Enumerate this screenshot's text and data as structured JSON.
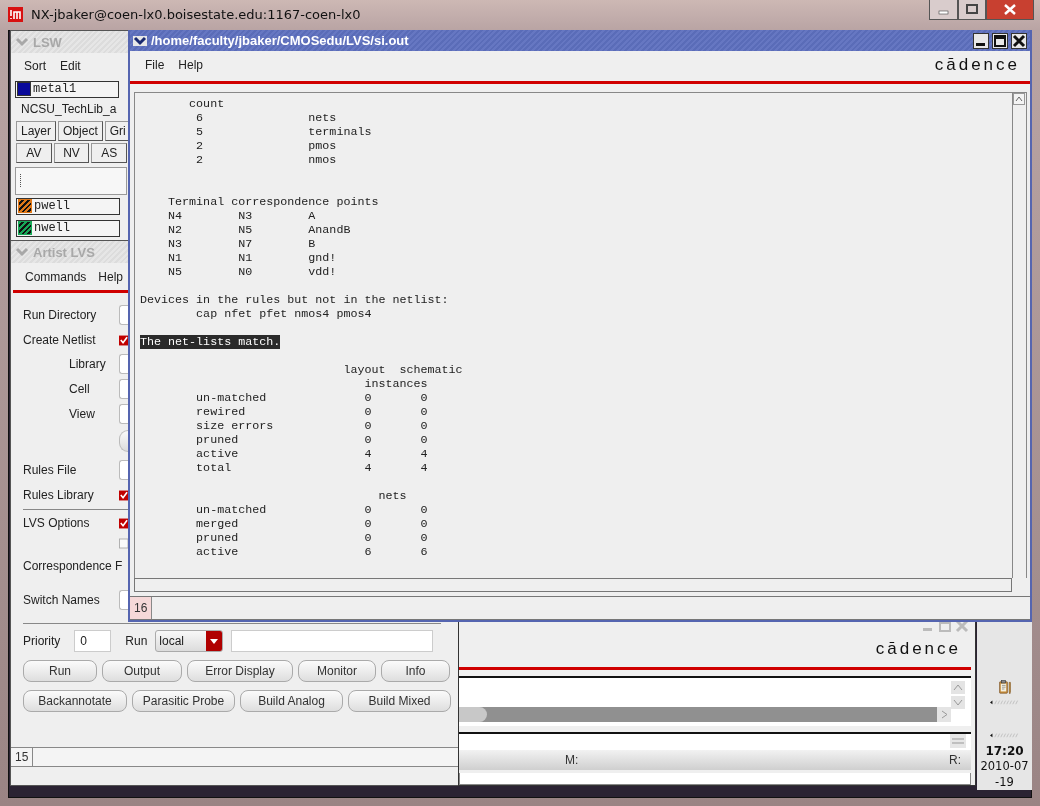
{
  "host_window": {
    "title": "NX-jbaker@coen-lx0.boisestate.edu:1167-coen-lx0"
  },
  "lsw": {
    "title": "LSW",
    "menu": [
      "Sort",
      "Edit"
    ],
    "current_layer": {
      "name": "metal1",
      "color": "#0a0a9a"
    },
    "technology": "NCSU_TechLib_a",
    "tabs": [
      "Layer",
      "Object",
      "Gri"
    ],
    "buttons": [
      "AV",
      "NV",
      "AS"
    ],
    "layers": [
      {
        "name": "pwell",
        "color": "#e07818"
      },
      {
        "name": "nwell",
        "color": "#18a858"
      }
    ]
  },
  "artist_lvs": {
    "title": "Artist LVS",
    "menu": [
      "Commands",
      "Help"
    ],
    "sections": [
      [
        {
          "kind": "field",
          "label": "Run Directory"
        },
        {
          "kind": "checkbox",
          "label": "Create Netlist",
          "checked": true
        },
        {
          "kind": "subfield",
          "label": "Library"
        },
        {
          "kind": "subfield",
          "label": "Cell"
        },
        {
          "kind": "subfield",
          "label": "View"
        },
        {
          "kind": "button"
        },
        {
          "kind": "field",
          "label": "Rules File"
        },
        {
          "kind": "checkbox",
          "label": "Rules Library",
          "checked": true
        }
      ],
      [
        {
          "kind": "checkbox",
          "label": "LVS Options",
          "checked": true
        },
        {
          "kind": "checkbox",
          "checked": false
        },
        {
          "kind": "field",
          "label": "Correspondence F"
        },
        {
          "kind": "field",
          "label": "Switch Names"
        }
      ]
    ],
    "priority": {
      "label": "Priority",
      "value": "0"
    },
    "run": {
      "label": "Run",
      "value": "local"
    },
    "button_rows": [
      [
        "Run",
        "Output",
        "Error Display",
        "Monitor",
        "Info"
      ],
      [
        "Backannotate",
        "Parasitic Probe",
        "Build Analog",
        "Build Mixed"
      ]
    ],
    "status": "15"
  },
  "output_window": {
    "title": "/home/faculty/jbaker/CMOSedu/LVS/si.out",
    "menu": [
      "File",
      "Help"
    ],
    "logo": "cādence",
    "blocks": [
      {
        "highlighted": false,
        "lines": [
          "       count",
          "        6               nets",
          "        5               terminals",
          "        2               pmos",
          "        2               nmos"
        ]
      },
      {
        "highlighted": false,
        "lines": [
          "    Terminal correspondence points",
          "    N4        N3        A",
          "    N2        N5        AnandB",
          "    N3        N7        B",
          "    N1        N1        gnd!",
          "    N5        N0        vdd!"
        ]
      },
      {
        "highlighted": false,
        "lines": [
          "Devices in the rules but not in the netlist:",
          "        cap nfet pfet nmos4 pmos4"
        ]
      },
      {
        "highlighted": true,
        "lines": [
          "The net-lists match."
        ]
      },
      {
        "highlighted": false,
        "lines": [
          "                             layout  schematic",
          "                                instances",
          "        un-matched              0       0",
          "        rewired                 0       0",
          "        size errors             0       0",
          "        pruned                  0       0",
          "        active                  4       4",
          "        total                   4       4"
        ]
      },
      {
        "highlighted": false,
        "lines": [
          "                                  nets",
          "        un-matched              0       0",
          "        merged                  0       0",
          "        pruned                  0       0",
          "        active                  6       6"
        ]
      }
    ],
    "status": "16"
  },
  "ciw": {
    "logo": "cādence",
    "status": [
      "M:",
      "R:"
    ]
  },
  "clock": {
    "time": "17:20",
    "date_lines": [
      "2010-07",
      "-19"
    ]
  }
}
